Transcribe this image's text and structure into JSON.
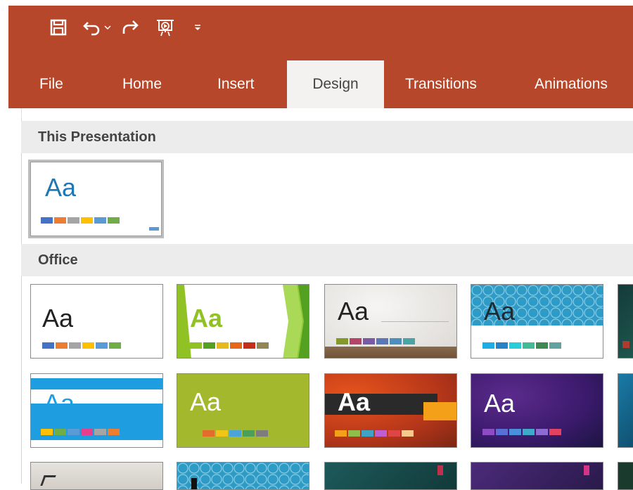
{
  "qat": {
    "icons": [
      "save-icon",
      "undo-icon",
      "undo-dropdown-icon",
      "redo-icon",
      "present-from-beginning-icon",
      "customize-toolbar-icon"
    ]
  },
  "tabs": [
    {
      "label": "File",
      "active": false
    },
    {
      "label": "Home",
      "active": false
    },
    {
      "label": "Insert",
      "active": false
    },
    {
      "label": "Design",
      "active": true
    },
    {
      "label": "Transitions",
      "active": false
    },
    {
      "label": "Animations",
      "active": false
    }
  ],
  "gallery": {
    "section_this": "This Presentation",
    "section_office": "Office",
    "thumb_text": "Aa"
  },
  "colors": {
    "ribbon": "#b7472a",
    "accent_blue": "#1f78b4"
  }
}
